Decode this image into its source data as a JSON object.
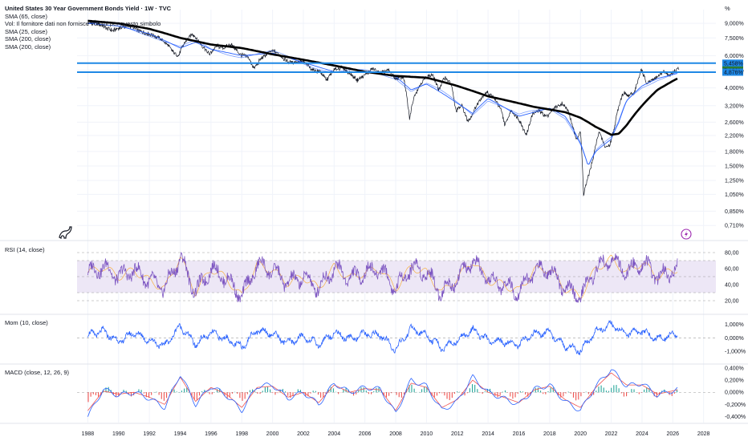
{
  "header": {
    "title": "United States 30 Year Government Bonds Yield · 1W · TVC",
    "legend": [
      "SMA (65, close)",
      "Vol: Il fornitore dati non fornisce volumi per questo simbolo",
      "SMA (25, close)",
      "SMA (200, close)",
      "SMA (200, close)"
    ],
    "unit": "%"
  },
  "panes": {
    "rsi_label": "RSI (14, close)",
    "mom_label": "Mom (10, close)",
    "macd_label": "MACD (close, 12, 26, 9)"
  },
  "colors": {
    "price": "#131722",
    "sma_short": "#2962ff",
    "sma_long": "#000000",
    "level_line": "#1e88e5",
    "rsi": "#7e57c2",
    "rsi_signal": "#f9a825",
    "rsi_band": "#ede7f6",
    "momentum": "#2962ff",
    "macd": "#2962ff",
    "macd_signal": "#ef5350",
    "hist_pos": "#26a69a",
    "hist_neg": "#ef5350"
  },
  "icons": {
    "logo": "dinosaur-logo-icon",
    "event": "lightning-icon"
  },
  "chart_data": [
    {
      "type": "line",
      "pane": "price",
      "title": "United States 30 Year Government Bonds Yield · 1W · TVC",
      "x_ticks": [
        "1988",
        "1990",
        "1992",
        "1994",
        "1996",
        "1998",
        "2000",
        "2002",
        "2004",
        "2006",
        "2008",
        "2010",
        "2012",
        "2014",
        "2016",
        "2018",
        "2020",
        "2022",
        "2024",
        "2026",
        "2028"
      ],
      "xlim": [
        1987.3,
        2028.8
      ],
      "y_scale": "log",
      "ylim": [
        0.65,
        10.7
      ],
      "y_ticks": [
        "9,000%",
        "7,500%",
        "6,000%",
        "5,000%",
        "4,000%",
        "3,200%",
        "2,600%",
        "2,200%",
        "1,800%",
        "1,500%",
        "1,250%",
        "1,050%",
        "0,850%",
        "0,710%"
      ],
      "level_labels": [
        "5,458%",
        "5,122%",
        "4,876%"
      ],
      "levels": [
        5.458,
        4.876
      ],
      "series": [
        {
          "role": "price",
          "x": [
            1988.0,
            1988.5,
            1989.0,
            1989.6,
            1990.2,
            1990.8,
            1991.3,
            1991.9,
            1992.5,
            1993.1,
            1993.6,
            1993.9,
            1994.3,
            1994.8,
            1995.3,
            1995.9,
            1996.4,
            1996.8,
            1997.3,
            1997.9,
            1998.4,
            1998.8,
            1999.2,
            1999.7,
            2000.1,
            2000.6,
            2001.1,
            2001.6,
            2002.1,
            2002.6,
            2003.1,
            2003.5,
            2004.0,
            2004.5,
            2005.0,
            2005.5,
            2006.0,
            2006.5,
            2007.0,
            2007.5,
            2008.0,
            2008.5,
            2008.9,
            2009.2,
            2009.6,
            2010.0,
            2010.4,
            2010.8,
            2011.2,
            2011.6,
            2011.9,
            2012.3,
            2012.7,
            2013.0,
            2013.5,
            2013.9,
            2014.3,
            2014.8,
            2015.1,
            2015.5,
            2016.0,
            2016.5,
            2016.9,
            2017.3,
            2017.8,
            2018.3,
            2018.8,
            2019.2,
            2019.7,
            2020.0,
            2020.2,
            2020.5,
            2020.8,
            2021.2,
            2021.6,
            2021.9,
            2022.2,
            2022.5,
            2022.8,
            2023.1,
            2023.5,
            2023.8,
            2023.95,
            2024.3,
            2024.7,
            2025.0,
            2025.4,
            2025.8,
            2026.1,
            2026.4
          ],
          "y": [
            9.0,
            9.1,
            8.7,
            8.2,
            8.6,
            8.7,
            8.2,
            7.9,
            7.6,
            7.0,
            6.2,
            6.0,
            7.1,
            7.9,
            7.0,
            6.1,
            6.8,
            6.6,
            6.9,
            6.1,
            5.9,
            5.1,
            5.7,
            6.2,
            6.4,
            5.9,
            5.5,
            5.6,
            5.5,
            5.0,
            4.9,
            4.4,
            5.0,
            5.2,
            4.8,
            4.4,
            4.7,
            5.1,
            4.8,
            5.0,
            4.5,
            4.6,
            2.7,
            3.6,
            4.2,
            4.6,
            4.7,
            3.9,
            4.6,
            4.2,
            3.0,
            3.2,
            2.6,
            2.9,
            3.5,
            3.8,
            3.6,
            3.1,
            2.5,
            3.0,
            2.7,
            2.2,
            2.9,
            3.0,
            2.8,
            3.1,
            3.3,
            3.0,
            2.1,
            2.3,
            1.05,
            1.3,
            1.6,
            2.3,
            1.9,
            1.95,
            2.4,
            3.2,
            3.8,
            3.6,
            3.8,
            4.5,
            5.1,
            4.2,
            4.4,
            4.6,
            4.9,
            4.7,
            4.9,
            5.1
          ]
        },
        {
          "role": "sma_long",
          "name": "SMA (200, close)",
          "x": [
            1988.0,
            1990,
            1992,
            1994,
            1996,
            1998,
            2000,
            2002,
            2004,
            2006,
            2008,
            2010,
            2012,
            2014,
            2016,
            2017,
            2018,
            2019,
            2020,
            2021,
            2022,
            2022.5,
            2023,
            2024,
            2025,
            2026.3
          ],
          "y": [
            9.3,
            9.0,
            8.4,
            7.5,
            6.9,
            6.6,
            6.1,
            5.7,
            5.3,
            4.9,
            4.65,
            4.55,
            4.1,
            3.6,
            3.3,
            3.15,
            3.05,
            2.95,
            2.75,
            2.45,
            2.22,
            2.25,
            2.5,
            3.2,
            3.9,
            4.5
          ]
        },
        {
          "role": "sma_short",
          "name": "SMA (25, close)",
          "x": [
            1988.0,
            1990,
            1992,
            1994,
            1995,
            1996,
            1998,
            2000,
            2002,
            2004,
            2006,
            2008,
            2009,
            2010,
            2012,
            2013,
            2014,
            2016,
            2018,
            2019,
            2020,
            2020.5,
            2021,
            2022,
            2022.5,
            2023,
            2024,
            2025,
            2026.3
          ],
          "y": [
            9.0,
            8.7,
            7.9,
            6.6,
            7.1,
            6.5,
            6.0,
            6.2,
            5.5,
            4.9,
            4.9,
            4.6,
            3.9,
            4.2,
            3.3,
            2.9,
            3.5,
            2.8,
            3.1,
            2.8,
            2.0,
            1.5,
            1.8,
            2.1,
            2.6,
            3.4,
            4.1,
            4.5,
            4.8
          ]
        }
      ]
    },
    {
      "type": "line",
      "pane": "rsi",
      "title": "RSI (14, close)",
      "ylim": [
        15,
        85
      ],
      "y_ticks": [
        "80,00",
        "60,00",
        "40,00",
        "20,00"
      ],
      "bands": [
        30,
        50,
        70
      ],
      "bounds": [
        20,
        80
      ],
      "x": [
        1988.0,
        1989,
        1990,
        1991,
        1992,
        1993,
        1994,
        1995,
        1996,
        1997,
        1998,
        1999,
        2000,
        2001,
        2002,
        2003,
        2004,
        2005,
        2006,
        2007,
        2008,
        2009,
        2010,
        2011,
        2012,
        2013,
        2014,
        2015,
        2016,
        2017,
        2018,
        2019,
        2020,
        2021,
        2022,
        2023,
        2024,
        2025,
        2026.3
      ],
      "y": [
        55,
        62,
        50,
        58,
        45,
        35,
        75,
        30,
        60,
        48,
        25,
        65,
        58,
        42,
        50,
        35,
        62,
        48,
        55,
        60,
        35,
        62,
        55,
        30,
        48,
        70,
        45,
        40,
        32,
        58,
        60,
        35,
        25,
        60,
        72,
        55,
        68,
        50,
        60
      ]
    },
    {
      "type": "line",
      "pane": "momentum",
      "title": "Mom (10, close)",
      "y_ticks": [
        "1,000%",
        "0,000%",
        "-1,000%"
      ],
      "ylim": [
        -1.6,
        1.4
      ],
      "x": [
        1988.0,
        1989,
        1990,
        1991,
        1992,
        1993,
        1994,
        1995,
        1996,
        1997,
        1998,
        1999,
        2000,
        2001,
        2002,
        2003,
        2004,
        2005,
        2006,
        2007,
        2008,
        2009,
        2010,
        2011,
        2012,
        2013,
        2014,
        2015,
        2016,
        2017,
        2018,
        2019,
        2020,
        2021,
        2022,
        2023,
        2024,
        2025,
        2026.3
      ],
      "y": [
        0.2,
        0.5,
        -0.3,
        0.4,
        -0.2,
        -0.6,
        0.9,
        -0.5,
        0.4,
        -0.1,
        -0.7,
        0.6,
        0.3,
        -0.4,
        0.1,
        -0.5,
        0.4,
        -0.1,
        0.3,
        0.2,
        -0.9,
        0.7,
        0.2,
        -0.8,
        -0.2,
        0.6,
        -0.2,
        -0.3,
        -0.5,
        0.3,
        0.4,
        -0.6,
        -1.0,
        0.5,
        1.0,
        0.3,
        0.5,
        -0.1,
        0.3
      ]
    },
    {
      "type": "line",
      "pane": "macd",
      "title": "MACD (close, 12, 26, 9)",
      "y_ticks": [
        "0,400%",
        "0,200%",
        "0,000%",
        "-0,200%",
        "-0,400%"
      ],
      "ylim": [
        -0.47,
        0.45
      ],
      "x": [
        1988.0,
        1989,
        1990,
        1991,
        1992,
        1993,
        1994,
        1995,
        1996,
        1997,
        1998,
        1999,
        2000,
        2001,
        2002,
        2003,
        2004,
        2005,
        2006,
        2007,
        2008,
        2009,
        2010,
        2011,
        2012,
        2013,
        2014,
        2015,
        2016,
        2017,
        2018,
        2019,
        2020,
        2021,
        2022,
        2023,
        2024,
        2025,
        2026.3
      ],
      "series": [
        {
          "role": "macd",
          "values": [
            -0.4,
            0.05,
            -0.05,
            0.0,
            -0.1,
            -0.25,
            0.3,
            -0.2,
            0.1,
            -0.05,
            -0.3,
            0.1,
            0.12,
            -0.1,
            0.0,
            -0.2,
            0.15,
            0.0,
            0.08,
            0.05,
            -0.35,
            0.2,
            0.1,
            -0.3,
            -0.15,
            0.25,
            0.0,
            -0.1,
            -0.2,
            0.05,
            0.12,
            -0.15,
            -0.3,
            0.1,
            0.38,
            0.1,
            0.15,
            -0.05,
            0.05
          ]
        },
        {
          "role": "signal",
          "values": [
            -0.3,
            0.02,
            -0.03,
            0.0,
            -0.08,
            -0.2,
            0.25,
            -0.15,
            0.08,
            -0.03,
            -0.25,
            0.08,
            0.1,
            -0.08,
            0.0,
            -0.17,
            0.12,
            0.0,
            0.06,
            0.04,
            -0.3,
            0.15,
            0.08,
            -0.25,
            -0.12,
            0.2,
            0.0,
            -0.08,
            -0.17,
            0.04,
            0.1,
            -0.12,
            -0.25,
            0.08,
            0.32,
            0.12,
            0.12,
            -0.03,
            0.04
          ]
        }
      ]
    }
  ]
}
